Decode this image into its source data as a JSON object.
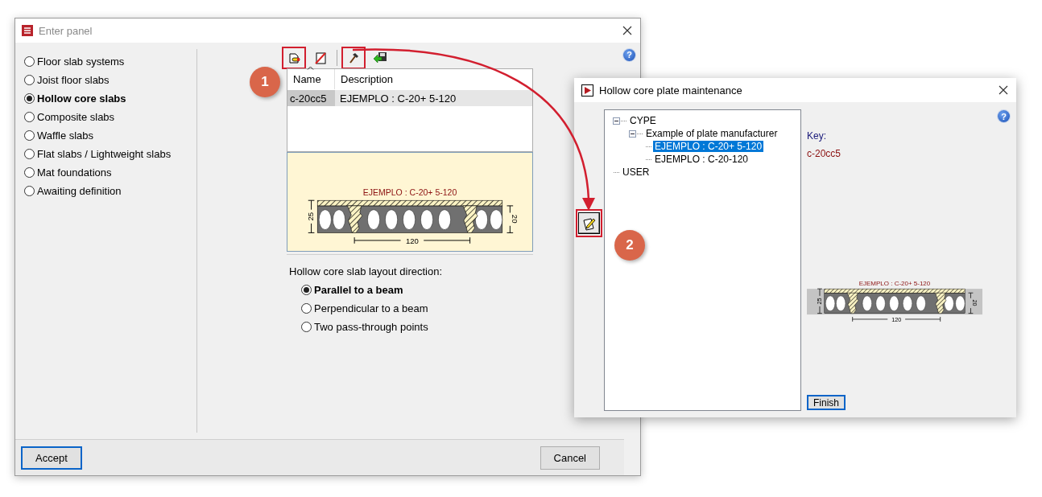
{
  "main_window": {
    "title": "Enter panel",
    "help": "?",
    "slab_types": [
      {
        "label": "Floor slab systems",
        "selected": false
      },
      {
        "label": "Joist floor slabs",
        "selected": false
      },
      {
        "label": "Hollow core slabs",
        "selected": true
      },
      {
        "label": "Composite slabs",
        "selected": false
      },
      {
        "label": "Waffle slabs",
        "selected": false
      },
      {
        "label": "Flat slabs / Lightweight slabs",
        "selected": false
      },
      {
        "label": "Mat foundations",
        "selected": false
      },
      {
        "label": "Awaiting definition",
        "selected": false
      }
    ],
    "toolbar": [
      {
        "kind": "new",
        "highlighted": true
      },
      {
        "kind": "delete",
        "highlighted": false
      },
      {
        "kind": "edit",
        "highlighted": true
      },
      {
        "kind": "import",
        "highlighted": false
      }
    ],
    "table": {
      "columns": [
        "Name",
        "Description"
      ],
      "rows": [
        {
          "name": "c-20cc5",
          "description": "EJEMPLO : C-20+ 5-120",
          "selected": true
        }
      ]
    },
    "preview": {
      "caption": "EJEMPLO : C-20+ 5-120",
      "height_label": "25",
      "depth_label": "20",
      "width_label": "120"
    },
    "direction": {
      "label": "Hollow core slab layout direction:",
      "options": [
        {
          "label": "Parallel to a beam",
          "selected": true
        },
        {
          "label": "Perpendicular to a beam",
          "selected": false
        },
        {
          "label": "Two pass-through points",
          "selected": false
        }
      ]
    },
    "buttons": [
      {
        "label": "Accept",
        "default": true
      },
      {
        "label": "Cancel",
        "default": false
      }
    ]
  },
  "maintenance_window": {
    "title": "Hollow core plate maintenance",
    "help": "?",
    "edit_button": {
      "highlighted": true
    },
    "tree": [
      {
        "label": "CYPE",
        "expanded": true,
        "selected": false,
        "children": [
          {
            "label": "Example of plate manufacturer",
            "expanded": true,
            "selected": false,
            "children": [
              {
                "label": "EJEMPLO : C-20+ 5-120",
                "selected": true
              },
              {
                "label": "EJEMPLO : C-20-120",
                "selected": false
              }
            ]
          }
        ]
      },
      {
        "label": "USER",
        "selected": false
      }
    ],
    "key_label": "Key:",
    "key_value": "c-20cc5",
    "preview": {
      "caption": "EJEMPLO : C-20+ 5-120",
      "height_label": "25",
      "depth_label": "20",
      "width_label": "120"
    },
    "finish_button": "Finish"
  },
  "callouts": [
    "1",
    "2"
  ]
}
